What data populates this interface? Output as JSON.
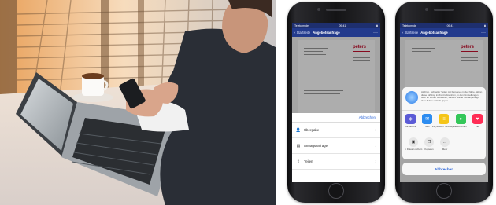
{
  "photo": {
    "icon": "photo-man-with-phone-and-laptop"
  },
  "phones": [
    {
      "status_carrier": "Telekom.de",
      "status_time": "09:41",
      "nav_back": "Startseite",
      "nav_title": "Angebotsanfrage",
      "doc_logo": "peters",
      "sheet": {
        "done_label": "Abbrechen",
        "options": [
          {
            "icon": "person-icon",
            "label": "Übergabe"
          },
          {
            "icon": "document-icon",
            "label": "Antragsanfrage"
          },
          {
            "icon": "share-icon",
            "label": "Teilen"
          }
        ]
      }
    },
    {
      "status_carrier": "Telekom.de",
      "status_time": "09:41",
      "nav_back": "Startseite",
      "nav_title": "Angebotsanfrage",
      "doc_logo": "peters",
      "share": {
        "airdrop_text": "AirDrop. Schneller Teilen mit Personen in der Nähe. Wenn diese AirDrop im Kontrollzentrum, in den Einstellungen oder im Finder aktivieren, wird ihr Name hier angezeigt. Zum Teilen einfach tippen.",
        "apps": [
          {
            "label": "Kurzbefehle",
            "color": "#5b5bd6",
            "glyph": "◈"
          },
          {
            "label": "Mail",
            "color": "#2d8cf0",
            "glyph": "✉"
          },
          {
            "label": "Zu „Notizen“ hinzufügen",
            "color": "#f5c518",
            "glyph": "≡"
          },
          {
            "label": "Nachrichten",
            "color": "#34c759",
            "glyph": "●"
          },
          {
            "label": "Fav",
            "color": "#ff2d55",
            "glyph": "♥"
          }
        ],
        "actions": [
          {
            "label": "In Dateien sichern",
            "glyph": "▣"
          },
          {
            "label": "Kopieren",
            "glyph": "❐"
          },
          {
            "label": "Mehr",
            "glyph": "…"
          }
        ],
        "cancel_label": "Abbrechen"
      }
    }
  ]
}
